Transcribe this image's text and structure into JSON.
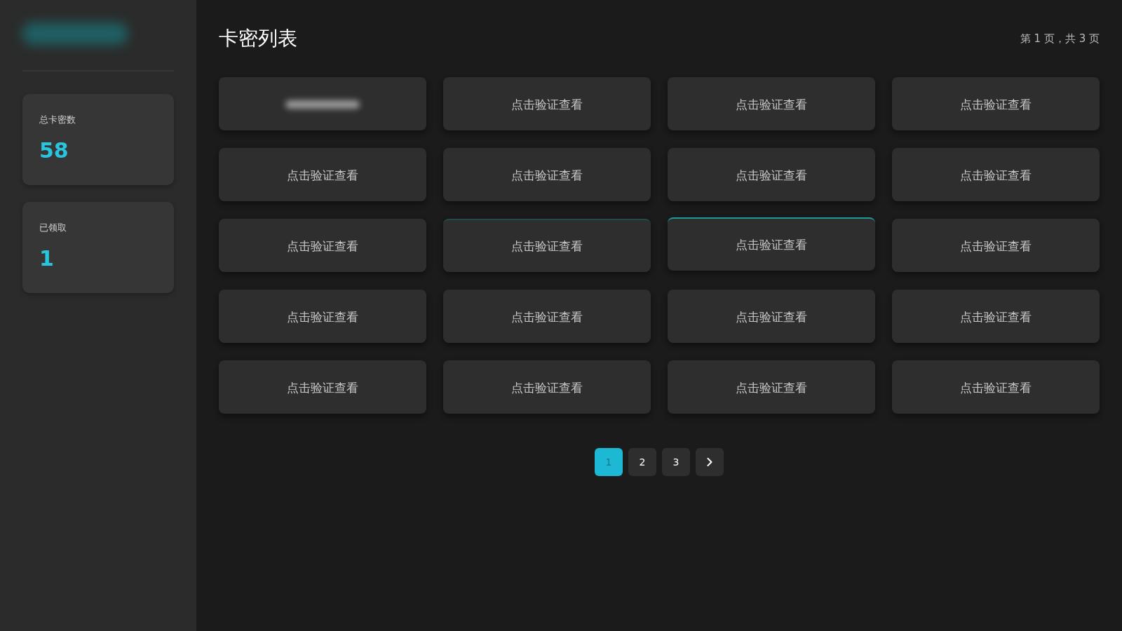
{
  "sidebar": {
    "stats": [
      {
        "label": "总卡密数",
        "value": "58"
      },
      {
        "label": "已领取",
        "value": "1"
      }
    ]
  },
  "header": {
    "title": "卡密列表",
    "page_info": "第 1 页，共 3 页"
  },
  "cards": [
    {
      "kind": "redacted",
      "highlighted": false,
      "hovered": false
    },
    {
      "kind": "prompt",
      "label": "点击验证查看",
      "highlighted": false,
      "hovered": false
    },
    {
      "kind": "prompt",
      "label": "点击验证查看",
      "highlighted": false,
      "hovered": false
    },
    {
      "kind": "prompt",
      "label": "点击验证查看",
      "highlighted": false,
      "hovered": false
    },
    {
      "kind": "prompt",
      "label": "点击验证查看",
      "highlighted": false,
      "hovered": false
    },
    {
      "kind": "prompt",
      "label": "点击验证查看",
      "highlighted": false,
      "hovered": false
    },
    {
      "kind": "prompt",
      "label": "点击验证查看",
      "highlighted": false,
      "hovered": false
    },
    {
      "kind": "prompt",
      "label": "点击验证查看",
      "highlighted": false,
      "hovered": false
    },
    {
      "kind": "prompt",
      "label": "点击验证查看",
      "highlighted": false,
      "hovered": false
    },
    {
      "kind": "prompt",
      "label": "点击验证查看",
      "highlighted": true,
      "hovered": false
    },
    {
      "kind": "prompt",
      "label": "点击验证查看",
      "highlighted": true,
      "hovered": true
    },
    {
      "kind": "prompt",
      "label": "点击验证查看",
      "highlighted": false,
      "hovered": false
    },
    {
      "kind": "prompt",
      "label": "点击验证查看",
      "highlighted": false,
      "hovered": false
    },
    {
      "kind": "prompt",
      "label": "点击验证查看",
      "highlighted": false,
      "hovered": false
    },
    {
      "kind": "prompt",
      "label": "点击验证查看",
      "highlighted": false,
      "hovered": false
    },
    {
      "kind": "prompt",
      "label": "点击验证查看",
      "highlighted": false,
      "hovered": false
    },
    {
      "kind": "prompt",
      "label": "点击验证查看",
      "highlighted": false,
      "hovered": false
    },
    {
      "kind": "prompt",
      "label": "点击验证查看",
      "highlighted": false,
      "hovered": false
    },
    {
      "kind": "prompt",
      "label": "点击验证查看",
      "highlighted": false,
      "hovered": false
    },
    {
      "kind": "prompt",
      "label": "点击验证查看",
      "highlighted": false,
      "hovered": false
    }
  ],
  "pagination": {
    "pages": [
      {
        "label": "1",
        "selected": true
      },
      {
        "label": "2",
        "selected": false
      },
      {
        "label": "3",
        "selected": false
      }
    ]
  }
}
